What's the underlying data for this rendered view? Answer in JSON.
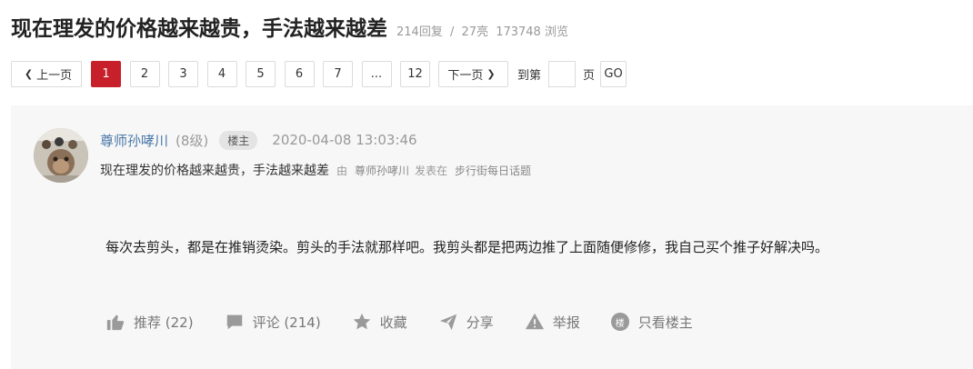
{
  "thread": {
    "title": "现在理发的价格越来越贵，手法越来越差",
    "replies": "214回复",
    "separator": "/",
    "lights": "27亮",
    "views": "173748 浏览"
  },
  "pager": {
    "prev_label": "上一页",
    "next_label": "下一页",
    "pages": [
      "1",
      "2",
      "3",
      "4",
      "5",
      "6",
      "7",
      "...",
      "12"
    ],
    "current_page": "1",
    "jump_prefix": "到第",
    "jump_suffix": "页",
    "go_label": "GO",
    "jump_value": ""
  },
  "post": {
    "author": "尊师孙哮川",
    "level": "(8级)",
    "badge": "楼主",
    "time": "2020-04-08 13:03:46",
    "subtitle": "现在理发的价格越来越贵，手法越来越差",
    "by_label": "由",
    "sub_user": "尊师孙哮川",
    "posted_in": "发表在",
    "board": "步行街每日话题",
    "content": "每次去剪头，都是在推销烫染。剪头的手法就那样吧。我剪头都是把两边推了上面随便修修，我自己买个推子好解决吗。"
  },
  "actions": {
    "recommend": "推荐 (22)",
    "comment": "评论 (214)",
    "favorite": "收藏",
    "share": "分享",
    "report": "举报",
    "owner_only_glyph": "楼",
    "owner_only": "只看楼主"
  },
  "colors": {
    "accent": "#c8202a",
    "link": "#4a78a8",
    "post_bg": "#f7f7f7",
    "icon_gray": "#9a9a9a"
  },
  "icons": [
    "thumbs-up-icon",
    "comment-bubble-icon",
    "star-icon",
    "share-arrow-icon",
    "warning-triangle-icon",
    "owner-circle-icon",
    "chevron-left-icon",
    "chevron-right-icon"
  ]
}
